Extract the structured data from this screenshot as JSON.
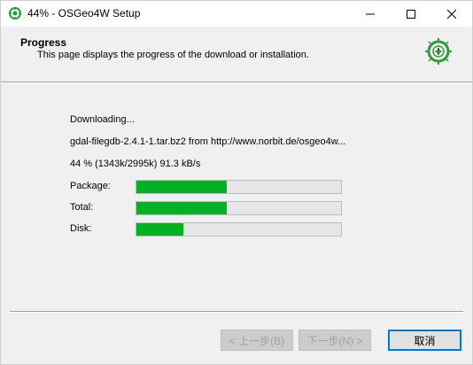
{
  "window": {
    "title": "44% - OSGeo4W Setup",
    "app_icon": "osgeo4w-icon"
  },
  "header": {
    "heading": "Progress",
    "subheading": "This page displays the progress of the download or installation.",
    "logo": "osgeo4w-logo"
  },
  "progress": {
    "status": "Downloading...",
    "file": "gdal-filegdb-2.4.1-1.tar.bz2 from http://www.norbit.de/osgeo4w...",
    "stats": "44 %  (1343k/2995k)  91.3 kB/s",
    "bars": [
      {
        "label": "Package:",
        "percent": 44
      },
      {
        "label": "Total:",
        "percent": 44
      },
      {
        "label": "Disk:",
        "percent": 23
      }
    ]
  },
  "buttons": {
    "back": "< 上一步(B)",
    "next": "下一步(N) >",
    "cancel": "取消"
  },
  "colors": {
    "progress_fill": "#06b025",
    "focus_border": "#0078d7",
    "logo_green": "#2e9b3c"
  }
}
